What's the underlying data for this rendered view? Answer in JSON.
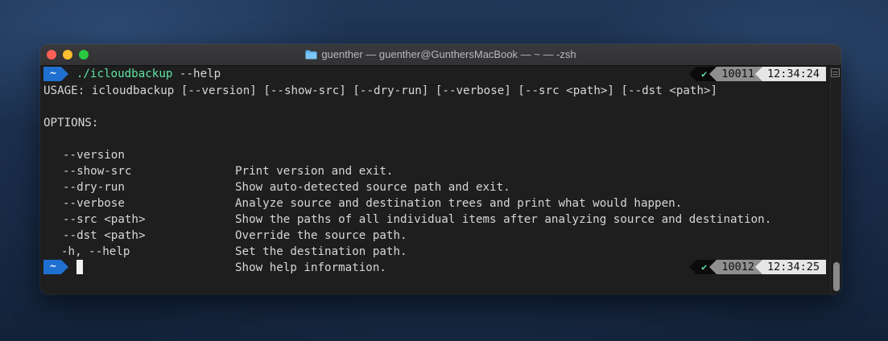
{
  "window": {
    "title": "guenther — guenther@GunthersMacBook — ~ — -zsh",
    "folder_icon": "folder-icon"
  },
  "prompt1": {
    "dir": "~",
    "command": "./icloudbackup",
    "args": " --help",
    "status": "✔",
    "history_number": "10011",
    "time": "12:34:24"
  },
  "usage": "USAGE: icloudbackup [--version] [--show-src] [--dry-run] [--verbose] [--src <path>] [--dst <path>]",
  "options_header": "OPTIONS:",
  "options": [
    {
      "flag": "--version",
      "description": "Print version and exit."
    },
    {
      "flag": "--show-src",
      "description": "Show auto-detected source path and exit."
    },
    {
      "flag": "--dry-run",
      "description": "Analyze source and destination trees and print what would happen."
    },
    {
      "flag": "--verbose",
      "description": "Show the paths of all individual items after analyzing source and destination."
    },
    {
      "flag": "--src <path>",
      "description": "Override the source path."
    },
    {
      "flag": "--dst <path>",
      "description": "Set the destination path."
    },
    {
      "flag": "-h, --help",
      "description": "Show help information."
    }
  ],
  "prompt2": {
    "dir": "~",
    "status": "✔",
    "history_number": "10012",
    "time": "12:34:25"
  },
  "colors": {
    "prompt_dir_bg": "#1f6fd1",
    "command": "#5fe3a1",
    "status_ok": "#5fe3a1",
    "terminal_bg": "#1e1e1e",
    "text": "#d7d7d7"
  }
}
